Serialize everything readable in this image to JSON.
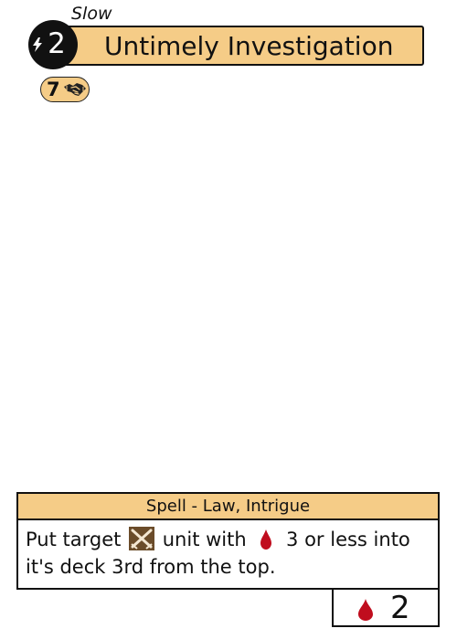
{
  "card": {
    "speed": "Slow",
    "name": "Untimely Investigation",
    "cost": "2",
    "influence": "7",
    "type_line": "Spell - Law, Intrigue",
    "text_before_unit": "Put target",
    "text_after_unit": "unit with",
    "text_after_blood": "3 or less into it's deck 3rd from the top.",
    "power": "2"
  },
  "icons": {
    "cost": "lightning-bolt-icon",
    "influence": "handshake-icon",
    "unit": "crossed-swords-icon",
    "blood": "blood-drop-icon"
  },
  "colors": {
    "banner": "#f5cc87",
    "cost_circle": "#111111",
    "blood": "#c00d1e",
    "unit_icon_bg": "#6b4c2a"
  }
}
